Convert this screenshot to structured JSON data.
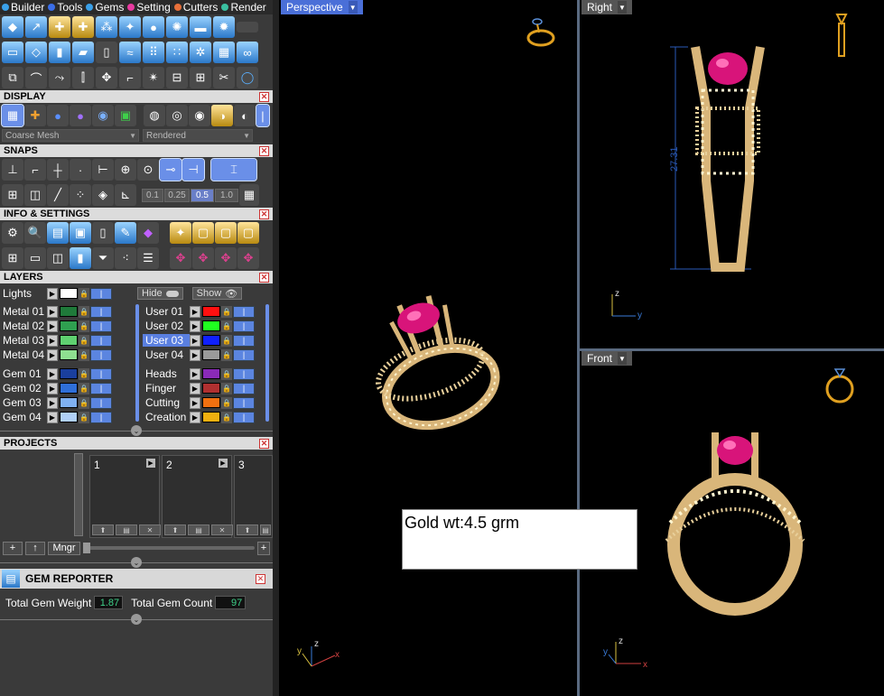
{
  "menubar": {
    "items": [
      {
        "label": "Builder",
        "dot": "#3aa0e8"
      },
      {
        "label": "Tools",
        "dot": "#3a6ee8"
      },
      {
        "label": "Gems",
        "dot": "#3aa0e8"
      },
      {
        "label": "Setting",
        "dot": "#e83aa0"
      },
      {
        "label": "Cutters",
        "dot": "#e8703a"
      },
      {
        "label": "Render",
        "dot": "#3ac0a0"
      }
    ]
  },
  "display": {
    "title": "DISPLAY",
    "mesh_mode": "Coarse Mesh",
    "render_mode": "Rendered"
  },
  "snaps": {
    "title": "SNAPS",
    "steps": [
      "0.1",
      "0.25",
      "0.5",
      "1.0"
    ],
    "selected_step": "0.5"
  },
  "info": {
    "title": "INFO & SETTINGS"
  },
  "layers": {
    "title": "LAYERS",
    "lights_label": "Lights",
    "hide_label": "Hide",
    "show_label": "Show",
    "left_col": [
      {
        "name": "Metal 01",
        "color": "#1f7a3a"
      },
      {
        "name": "Metal 02",
        "color": "#2fa050"
      },
      {
        "name": "Metal 03",
        "color": "#5fd070"
      },
      {
        "name": "Metal 04",
        "color": "#8ee090"
      },
      {
        "name": "Gem 01",
        "color": "#1a3f9e"
      },
      {
        "name": "Gem 02",
        "color": "#2f6fd8"
      },
      {
        "name": "Gem 03",
        "color": "#7fb0f0"
      },
      {
        "name": "Gem 04",
        "color": "#b0d0f8"
      }
    ],
    "right_col": [
      {
        "name": "User 01",
        "color": "#ff1010"
      },
      {
        "name": "User 02",
        "color": "#20ff20"
      },
      {
        "name": "User 03",
        "color": "#1020ff"
      },
      {
        "name": "User 04",
        "color": "#9a9a9a"
      },
      {
        "name": "Heads",
        "color": "#8a2ab8"
      },
      {
        "name": "Finger",
        "color": "#b03030"
      },
      {
        "name": "Cutting",
        "color": "#f07010"
      },
      {
        "name": "Creation",
        "color": "#f0b010"
      }
    ],
    "selected": "User 03"
  },
  "projects": {
    "title": "PROJECTS",
    "slots": [
      "1",
      "2",
      "3"
    ],
    "add_label": "+",
    "up_label": "↑",
    "manager_label": "Mngr"
  },
  "gem_reporter": {
    "title": "GEM REPORTER",
    "weight_label": "Total Gem Weight",
    "weight_value": "1.87",
    "count_label": "Total Gem Count",
    "count_value": "97"
  },
  "viewports": {
    "perspective": "Perspective",
    "right": "Right",
    "front": "Front",
    "dimension": "27.31"
  },
  "note": {
    "text": "Gold wt:4.5 grm"
  },
  "colors": {
    "metal": "#d9b67a",
    "gem": "#d8147a",
    "accent_blue": "#4a6fd8",
    "panel_bg": "#3a3a3a"
  }
}
